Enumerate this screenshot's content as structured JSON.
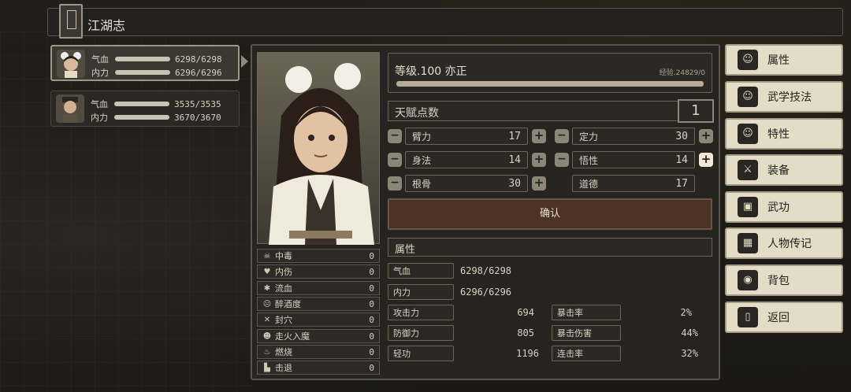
{
  "header": {
    "title": "江湖志",
    "book_label": "江湖志"
  },
  "characters": [
    {
      "hp_label": "气血",
      "hp": "6298/6298",
      "mp_label": "内力",
      "mp": "6296/6296"
    },
    {
      "hp_label": "气血",
      "hp": "3535/3535",
      "mp_label": "内力",
      "mp": "3670/3670"
    }
  ],
  "level": {
    "text": "等级.100 亦正",
    "exp": "经验.24829/0"
  },
  "talent": {
    "label": "天赋点数",
    "value": "1"
  },
  "stats": [
    {
      "name": "臂力",
      "value": "17"
    },
    {
      "name": "定力",
      "value": "30"
    },
    {
      "name": "身法",
      "value": "14"
    },
    {
      "name": "悟性",
      "value": "14"
    },
    {
      "name": "根骨",
      "value": "30"
    },
    {
      "name": "道德",
      "value": "17"
    }
  ],
  "confirm_label": "确认",
  "attributes": {
    "title": "属性",
    "hp_label": "气血",
    "hp": "6298/6298",
    "mp_label": "内力",
    "mp": "6296/6296",
    "rows": [
      {
        "k1": "攻击力",
        "v1": "694",
        "k2": "暴击率",
        "v2": "2%"
      },
      {
        "k1": "防御力",
        "v1": "805",
        "k2": "暴击伤害",
        "v2": "44%"
      },
      {
        "k1": "轻功",
        "v1": "1196",
        "k2": "连击率",
        "v2": "32%"
      }
    ]
  },
  "statuses": [
    {
      "icon": "☠",
      "name": "中毒",
      "value": "0"
    },
    {
      "icon": "♥",
      "name": "内伤",
      "value": "0"
    },
    {
      "icon": "✱",
      "name": "流血",
      "value": "0"
    },
    {
      "icon": "☹",
      "name": "醉酒度",
      "value": "0"
    },
    {
      "icon": "✕",
      "name": "封穴",
      "value": "0"
    },
    {
      "icon": "☻",
      "name": "走火入魔",
      "value": "0"
    },
    {
      "icon": "♨",
      "name": "燃烧",
      "value": "0"
    },
    {
      "icon": "▙",
      "name": "击退",
      "value": "0"
    }
  ],
  "menu": [
    {
      "label": "属性",
      "icon": "☺"
    },
    {
      "label": "武学技法",
      "icon": "☺"
    },
    {
      "label": "特性",
      "icon": "☺"
    },
    {
      "label": "装备",
      "icon": "⚔"
    },
    {
      "label": "武功",
      "icon": "▣"
    },
    {
      "label": "人物传记",
      "icon": "▦"
    },
    {
      "label": "背包",
      "icon": "◉"
    },
    {
      "label": "返回",
      "icon": "▯"
    }
  ]
}
